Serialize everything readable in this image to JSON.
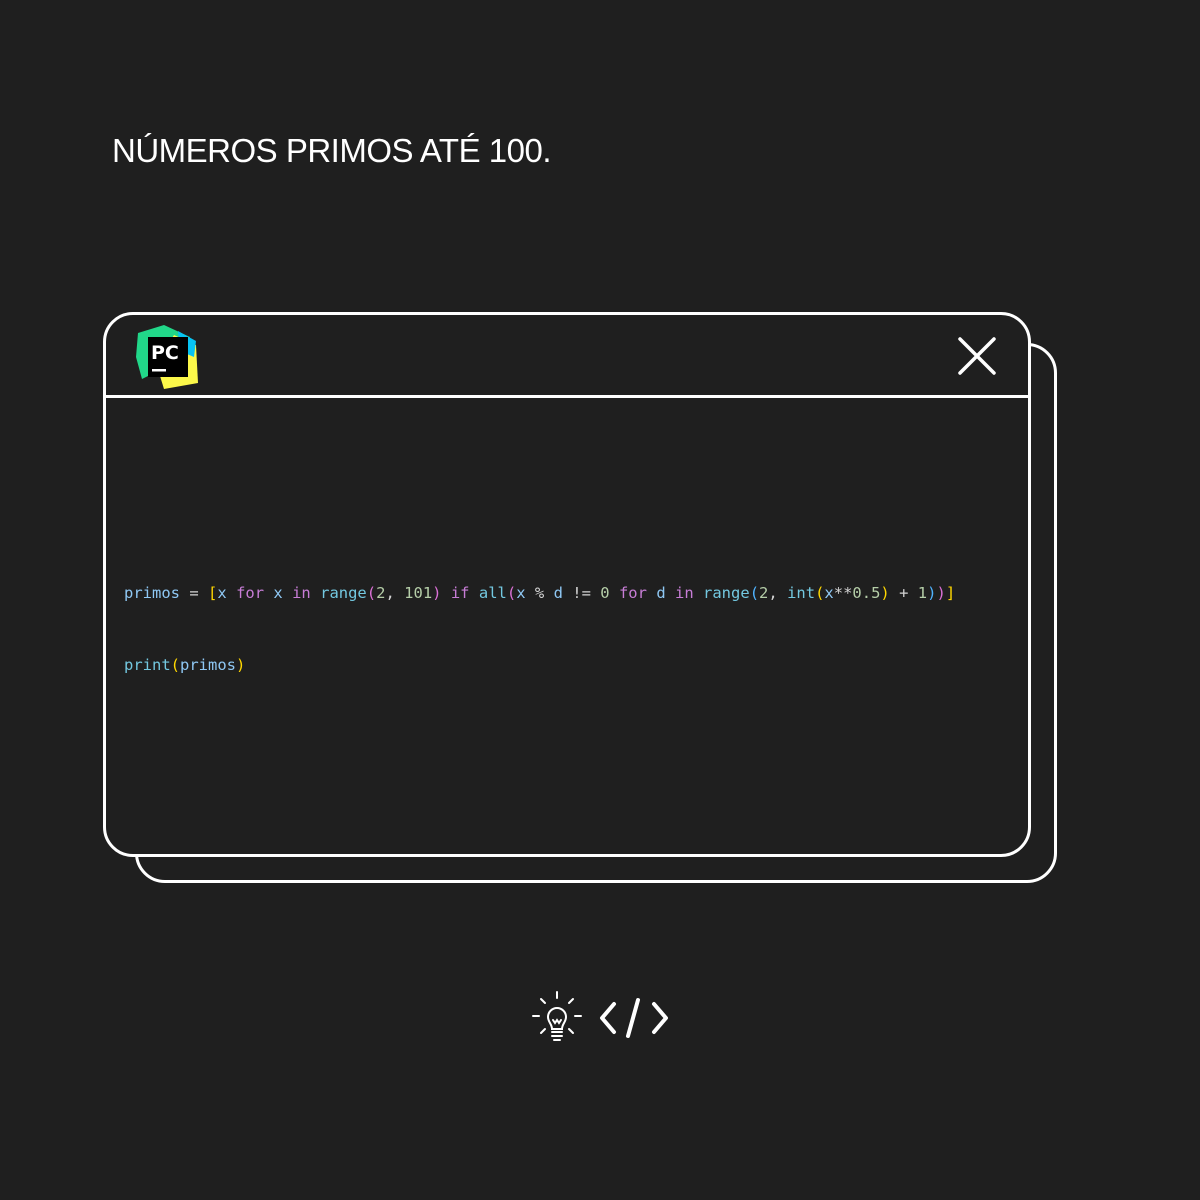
{
  "page": {
    "title": "NÚMEROS PRIMOS ATÉ 100."
  },
  "window": {
    "app_icon": "pycharm-logo-icon",
    "app_icon_text": "PC",
    "close_icon": "close-icon"
  },
  "code": {
    "lines": [
      "primos = [x for x in range(2, 101) if all(x % d != 0 for d in range(2, int(x**0.5) + 1))]",
      "print(primos)"
    ]
  },
  "footer": {
    "icons": [
      "lightbulb-icon",
      "code-brackets-icon"
    ]
  },
  "colors": {
    "background": "#1f1f1f",
    "border": "#ffffff",
    "variable": "#8fc8f4",
    "keyword": "#c77dd6",
    "function": "#73c8e0",
    "number": "#b5cea8",
    "bracket_level1": "#ffd700",
    "bracket_level2": "#da70d6",
    "bracket_level3": "#4fb3ff"
  }
}
